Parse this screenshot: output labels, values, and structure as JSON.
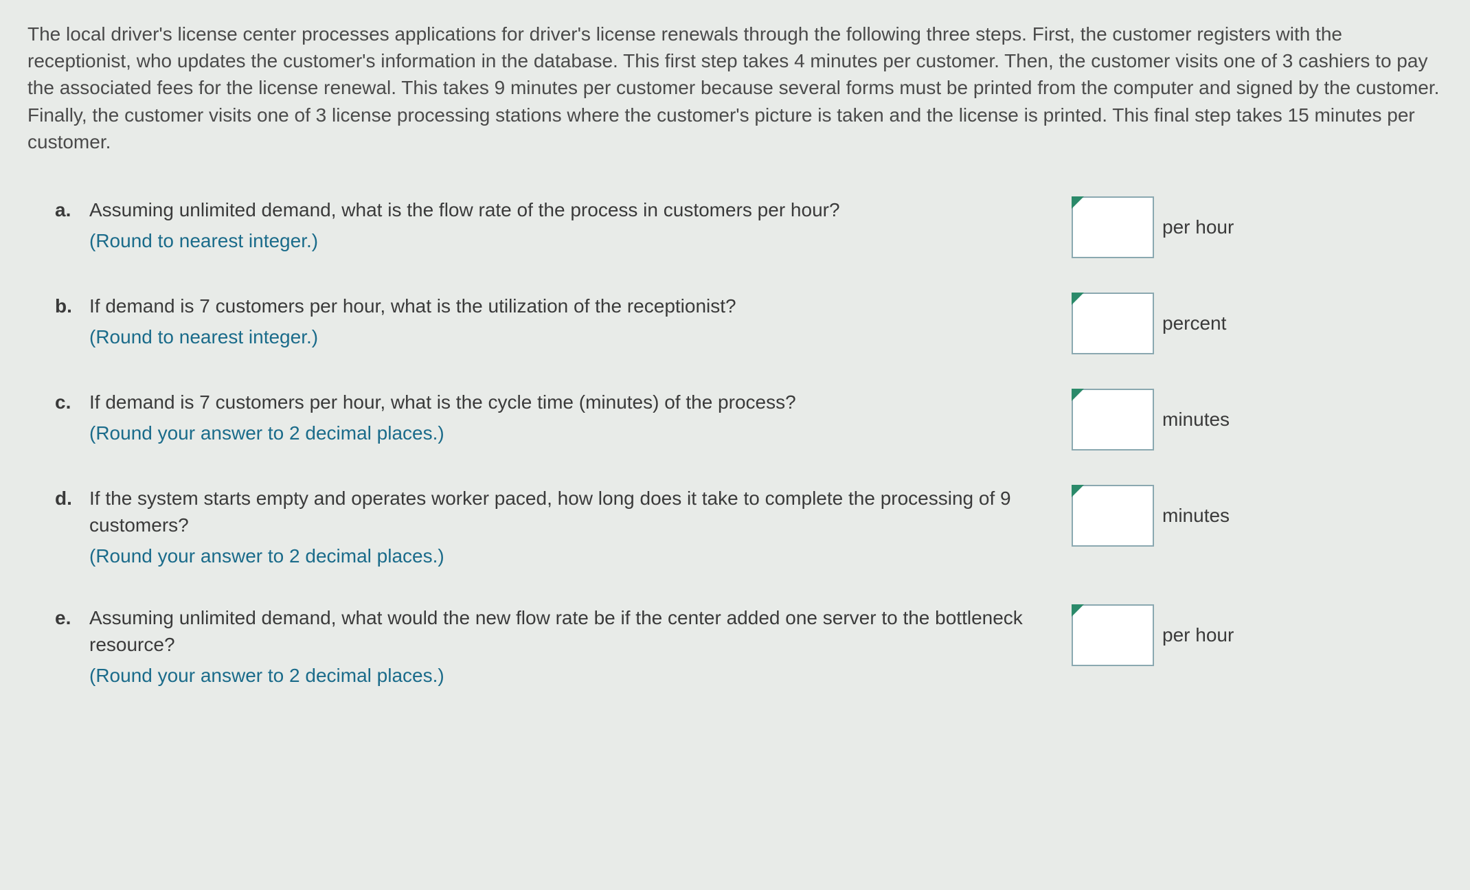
{
  "intro": "The local driver's license center processes applications for driver's license renewals through the following three steps. First, the customer registers with the receptionist, who updates the customer's information in the database. This first step takes 4 minutes per customer. Then, the customer visits one of 3 cashiers to pay the associated fees for the license renewal. This takes 9 minutes per customer because several forms must be printed from the computer and signed by the customer. Finally, the customer visits one of 3 license processing stations where the customer's picture is taken and the license is printed. This final step takes 15 minutes per customer.",
  "questions": [
    {
      "label": "a.",
      "text": "Assuming unlimited demand, what is the flow rate of the process in customers per hour?",
      "hint": "(Round to nearest integer.)",
      "unit": "per hour",
      "value": ""
    },
    {
      "label": "b.",
      "text": "If demand is 7 customers per hour, what is the utilization of the receptionist?",
      "hint": "(Round to nearest integer.)",
      "unit": "percent",
      "value": ""
    },
    {
      "label": "c.",
      "text": "If demand is 7 customers per hour, what is the cycle time (minutes) of the process?",
      "hint": "(Round your answer to 2 decimal places.)",
      "unit": "minutes",
      "value": ""
    },
    {
      "label": "d.",
      "text": "If the system starts empty and operates worker paced, how long does it take to complete the processing of 9 customers?",
      "hint": "(Round your answer to 2 decimal places.)",
      "unit": "minutes",
      "value": ""
    },
    {
      "label": "e.",
      "text": "Assuming unlimited demand, what would the new flow rate be if the center added one server to the bottleneck resource?",
      "hint": "(Round your answer to 2 decimal places.)",
      "unit": "per hour",
      "value": ""
    }
  ]
}
